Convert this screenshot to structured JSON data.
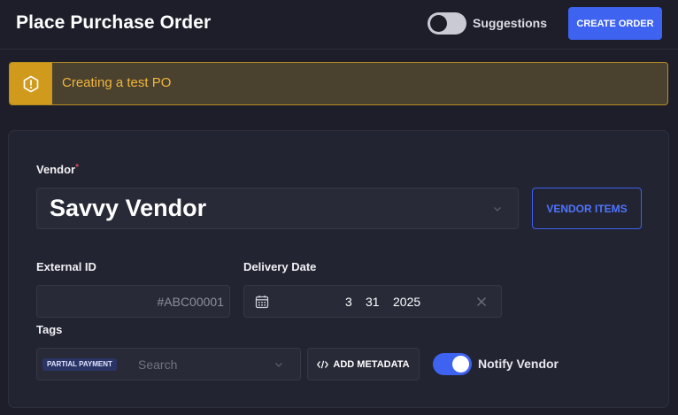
{
  "header": {
    "title": "Place Purchase Order",
    "suggestions_label": "Suggestions",
    "suggestions_enabled": false,
    "create_order_label": "CREATE ORDER"
  },
  "alert": {
    "icon": "warning-hexagon-icon",
    "message": "Creating a test PO",
    "colors": {
      "accent": "#d09a1c",
      "text": "#f2b73a"
    }
  },
  "form": {
    "vendor": {
      "label": "Vendor",
      "required_mark": "*",
      "value": "Savvy Vendor",
      "vendor_items_label": "VENDOR ITEMS"
    },
    "external_id": {
      "label": "External ID",
      "placeholder": "#ABC00001",
      "value": ""
    },
    "delivery_date": {
      "label": "Delivery Date",
      "month": "3",
      "day": "31",
      "year": "2025"
    },
    "tags": {
      "label": "Tags",
      "chips": [
        "PARTIAL PAYMENT"
      ],
      "placeholder": "Search"
    },
    "add_metadata_label": "ADD METADATA",
    "notify_vendor": {
      "label": "Notify Vendor",
      "enabled": true
    }
  },
  "colors": {
    "primary": "#3d63f0",
    "background": "#1d1e29",
    "card": "#232431"
  }
}
